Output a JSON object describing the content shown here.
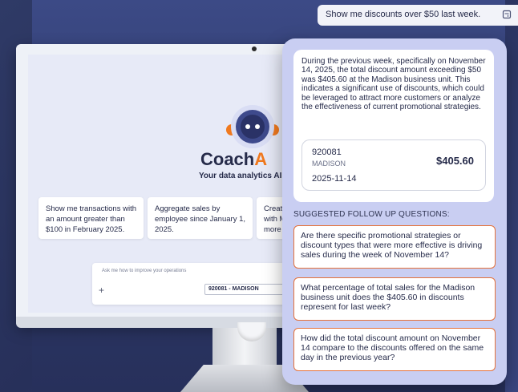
{
  "query": {
    "text": "Show me discounts over $50 last week."
  },
  "monitor_screen": {
    "brand_prefix": "Coach",
    "brand_accent": "A",
    "tagline": "Your data analytics AI a",
    "suggestions": [
      {
        "text": "Show me transactions with an amount greater than $100 in February 2025."
      },
      {
        "text": "Aggregate sales by employee since January 1, 2025."
      },
      {
        "text": "Create with M more t"
      }
    ],
    "prompt_placeholder": "Ask me how to improve your operations",
    "plus_label": "+",
    "unit_chip": "920081 - MADISON"
  },
  "answer": {
    "text": "During the previous week, specifically on November 14, 2025, the total discount amount exceeding $50 was $405.60 at the Madison business unit. This indicates a significant use of discounts, which could be leveraged to attract more customers or analyze the effectiveness of current promotional strategies.",
    "result": {
      "id": "920081",
      "unit": "MADISON",
      "date": "2025-11-14",
      "amount": "$405.60"
    }
  },
  "followups": {
    "title": "SUGGESTED FOLLOW UP QUESTIONS:",
    "items": [
      {
        "text": "Are there specific promotional strategies or discount types that were more effective is driving sales during the week of November 14?"
      },
      {
        "text": "What percentage of total sales for the Madison business unit does the $405.60 in discounts represent for last week?"
      },
      {
        "text": "How did the total discount amount on November 14 compare to the discounts offered on the same day in the previous year?"
      }
    ]
  },
  "colors": {
    "accent_orange": "#f0791e",
    "panel_lavender": "#c9cef2",
    "navy_text": "#262b4a"
  },
  "icons": [
    "copy-icon",
    "bot-logo-icon",
    "plus-icon"
  ]
}
